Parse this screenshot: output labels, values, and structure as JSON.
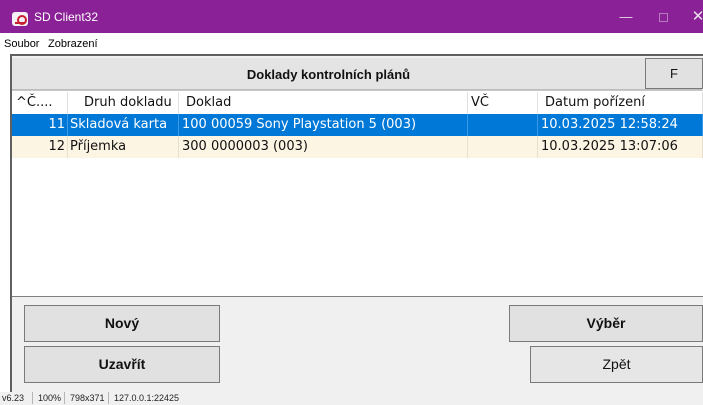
{
  "window": {
    "title": "SD Client32",
    "min_glyph": "—",
    "close_glyph": "✕"
  },
  "menu": {
    "items": [
      "Soubor",
      "Zobrazení"
    ]
  },
  "panel": {
    "title": "Doklady kontrolních plánů",
    "filter_button": "F"
  },
  "table": {
    "headers": [
      "^Č....",
      "Druh dokladu",
      "Doklad",
      "VČ",
      "Datum pořízení"
    ],
    "rows": [
      {
        "num": "11",
        "type": "Skladová karta",
        "doc": "100 00059 Sony Playstation 5 (003)",
        "vc": "",
        "date": "10.03.2025 12:58:24",
        "selected": true
      },
      {
        "num": "12",
        "type": "Příjemka",
        "doc": "300 0000003 (003)",
        "vc": "",
        "date": "10.03.2025 13:07:06",
        "selected": false
      }
    ]
  },
  "buttons": {
    "new": "Nový",
    "close": "Uzavřít",
    "select": "Výběr",
    "back": "Zpět"
  },
  "status": {
    "version": "v6.23",
    "zoom": "100%",
    "size": "798x371",
    "address": "127.0.0.1:22425"
  },
  "colors": {
    "titlebar": "#8a2196",
    "selection": "#0078d7",
    "alt_row": "#fdf5e4"
  }
}
